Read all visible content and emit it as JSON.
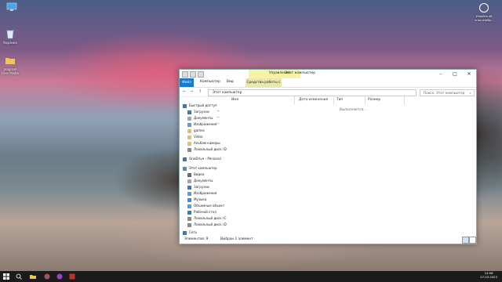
{
  "desktop": {
    "icons": [
      {
        "label": "",
        "icon": "monitor-icon"
      },
      {
        "label": "Корзина",
        "icon": "recycle-bin-icon"
      },
      {
        "label": "program Files Misha",
        "icon": "folder-icon"
      }
    ],
    "user": {
      "line1": "Узнайте об",
      "line2": "этом изобр..."
    }
  },
  "window": {
    "title": "Этот компьютер",
    "contextual_tab_group": "Управление",
    "controls": {
      "minimize": "–",
      "maximize": "□",
      "close": "✕"
    },
    "ribbon_tabs": [
      "Файл",
      "Компьютер",
      "Вид",
      "Средства работы с дисками"
    ],
    "address": "Этот компьютер",
    "search_placeholder": "Поиск: Этот компьютер",
    "nav": {
      "back": "←",
      "forward": "→",
      "up": "↑"
    }
  },
  "sidebar": {
    "items": [
      {
        "label": "Быстрый доступ",
        "icon": "star-icon",
        "color": "#2e7bd6",
        "pinned": false
      },
      {
        "label": "Загрузки",
        "icon": "download-icon",
        "color": "#2e7bd6",
        "pinned": true
      },
      {
        "label": "Документы",
        "icon": "document-icon",
        "color": "#9aa8b8",
        "pinned": true
      },
      {
        "label": "Изображения",
        "icon": "pictures-icon",
        "color": "#5a9fd6",
        "pinned": true
      },
      {
        "label": "games",
        "icon": "folder-icon",
        "color": "#e8c15a",
        "pinned": false
      },
      {
        "label": "Video",
        "icon": "folder-icon",
        "color": "#e8c15a",
        "pinned": false
      },
      {
        "label": "Альбом камеры",
        "icon": "folder-icon",
        "color": "#e8c15a",
        "pinned": false
      },
      {
        "label": "Локальный диск (D:",
        "icon": "drive-icon",
        "color": "#8a8a8a",
        "pinned": false
      },
      {
        "label": "OneDrive - Personal",
        "icon": "cloud-icon",
        "color": "#2e7bd6",
        "pinned": false
      },
      {
        "label": "Этот компьютер",
        "icon": "monitor-icon",
        "color": "#4a8fd0",
        "pinned": false
      },
      {
        "label": "Видео",
        "icon": "video-icon",
        "color": "#5a6e8a",
        "pinned": false
      },
      {
        "label": "Документы",
        "icon": "document-icon",
        "color": "#9aa8b8",
        "pinned": false
      },
      {
        "label": "Загрузки",
        "icon": "download-icon",
        "color": "#2e7bd6",
        "pinned": false
      },
      {
        "label": "Изображения",
        "icon": "pictures-icon",
        "color": "#5a9fd6",
        "pinned": false
      },
      {
        "label": "Музыка",
        "icon": "music-icon",
        "color": "#3a8fd6",
        "pinned": false
      },
      {
        "label": "Объемные объект",
        "icon": "cube-icon",
        "color": "#4aa0e0",
        "pinned": false
      },
      {
        "label": "Рабочий стол",
        "icon": "desktop-icon",
        "color": "#2e7bd6",
        "pinned": false
      },
      {
        "label": "Локальный диск (С",
        "icon": "drive-icon",
        "color": "#8a8a8a",
        "pinned": false
      },
      {
        "label": "Локальный диск (D",
        "icon": "drive-icon",
        "color": "#8a8a8a",
        "pinned": false
      },
      {
        "label": "Сеть",
        "icon": "network-icon",
        "color": "#2e7bd6",
        "pinned": false
      }
    ]
  },
  "content": {
    "columns": [
      "Имя",
      "Дата изменения",
      "Тип",
      "Размер"
    ],
    "working_text": "Выполняется..."
  },
  "status": {
    "items_count": "Элементов: 9",
    "selected": "Выбран 1 элемент"
  },
  "taskbar": {
    "icons": [
      "windows-icon",
      "search-icon",
      "task-view-icon",
      "file-explorer-icon",
      "browser-icon",
      "chat-icon",
      "app-icon"
    ],
    "time": "14:06",
    "date": "27.03.2023",
    "colors": {
      "bar": "#1b1b1b",
      "accent": "#1979ca"
    }
  }
}
